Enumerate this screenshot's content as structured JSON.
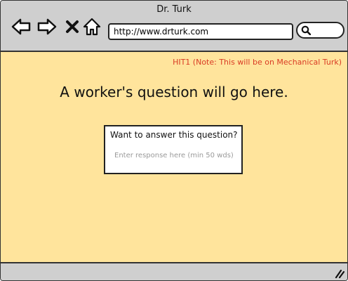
{
  "window": {
    "title": "Dr. Turk"
  },
  "toolbar": {
    "back_icon": "arrow-left-icon",
    "forward_icon": "arrow-right-icon",
    "close_icon": "x-icon",
    "home_icon": "home-icon",
    "url": "http://www.drturk.com",
    "search_icon": "magnifier-icon"
  },
  "page": {
    "note": "HIT1 (Note: This will be on Mechanical Turk)",
    "question": "A worker's question will go here.",
    "answer_card": {
      "title": "Want to answer this question?",
      "placeholder": "Enter response here (min 50 wds)"
    }
  },
  "colors": {
    "content_bg": "#ffe49c",
    "chrome_bg": "#cfcfcf",
    "note_text": "#d93b24"
  }
}
